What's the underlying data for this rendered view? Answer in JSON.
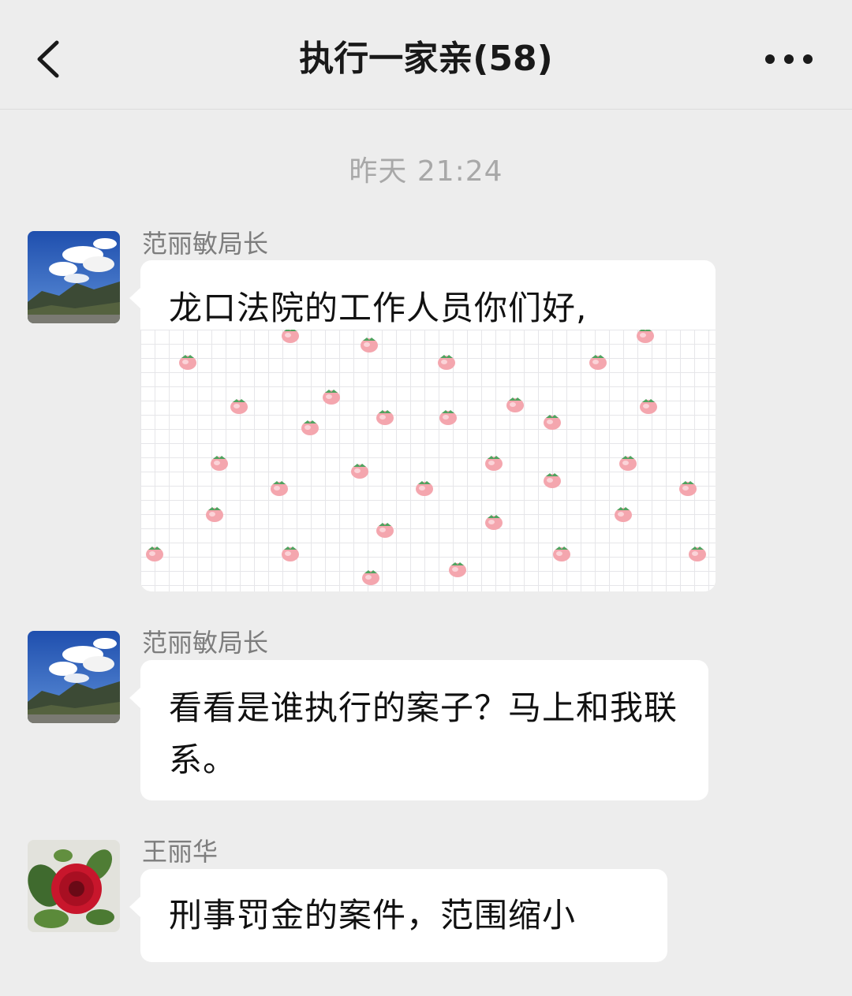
{
  "nav": {
    "title": "执行一家亲(58)",
    "back_icon": "chevron-left-icon",
    "more_icon": "ellipsis-icon"
  },
  "chat": {
    "timestamp": "昨天 21:24",
    "messages": [
      {
        "sender": "范丽敏局长",
        "text": "龙口法院的工作人员你们好,"
      },
      {
        "sender": "范丽敏局长",
        "text": "看看是谁执行的案子？马上和我联系。"
      },
      {
        "sender": "王丽华",
        "text": "刑事罚金的案件，范围缩小"
      }
    ]
  },
  "colors": {
    "background": "#ededed",
    "bubble": "#ffffff",
    "title_text": "#191919",
    "sender_text": "#7d7d7d",
    "timestamp_text": "#a8a8a8",
    "strawberry": "#f4a6ae",
    "leaf": "#4fa35f"
  }
}
